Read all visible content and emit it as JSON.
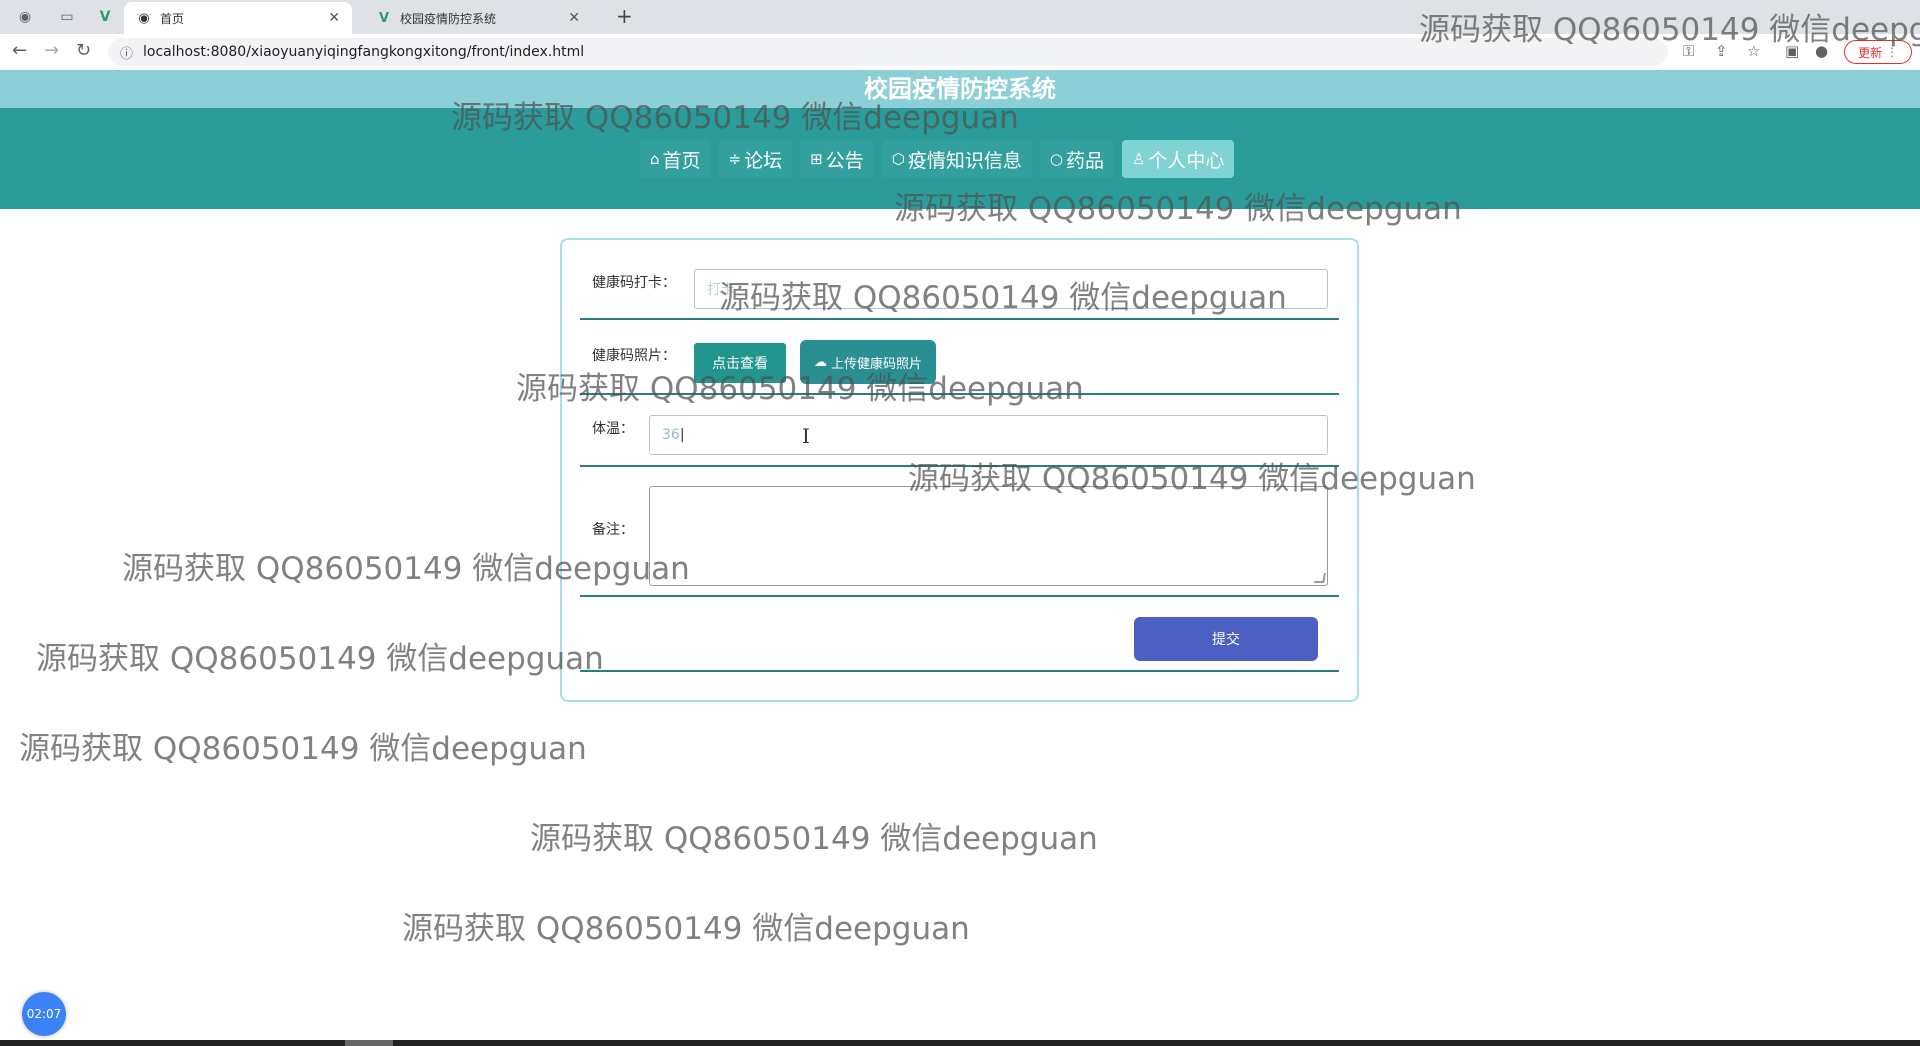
{
  "browser": {
    "tabs": [
      {
        "title": "首页",
        "active": true,
        "icon": "globe-icon"
      },
      {
        "title": "校园疫情防控系统",
        "active": false,
        "icon": "vue-logo-icon"
      }
    ],
    "url": "localhost:8080/xiaoyuanyiqingfangkongxitong/front/index.html",
    "update_label": "更新"
  },
  "site": {
    "title": "校园疫情防控系统"
  },
  "nav": {
    "items": [
      {
        "label": "首页",
        "icon": "home-icon",
        "glyph": "⌂"
      },
      {
        "label": "论坛",
        "icon": "forum-icon",
        "glyph": "≑"
      },
      {
        "label": "公告",
        "icon": "notice-icon",
        "glyph": "⊞"
      },
      {
        "label": "疫情知识信息",
        "icon": "cube-icon",
        "glyph": "⬡"
      },
      {
        "label": "药品",
        "icon": "pill-icon",
        "glyph": "○"
      },
      {
        "label": "个人中心",
        "icon": "user-icon",
        "glyph": "♙",
        "active": true
      }
    ]
  },
  "form": {
    "health_code_checkin": {
      "label": "健康码打卡：",
      "placeholder": "打卡"
    },
    "health_code_photo": {
      "label": "健康码照片：",
      "view_button": "点击查看",
      "upload_button": "上传健康码照片"
    },
    "temperature": {
      "label": "体温：",
      "value": "36"
    },
    "remark": {
      "label": "备注："
    },
    "submit_label": "提交"
  },
  "watermark_text": "源码获取 QQ86050149 微信deepguan",
  "timer": "02:07",
  "colors": {
    "header_light": "#8ccfd6",
    "header_dark": "#2a9d9a",
    "nav_active": "#7fd3d3",
    "submit_button": "#4c5fc2",
    "view_button": "#22958f"
  }
}
